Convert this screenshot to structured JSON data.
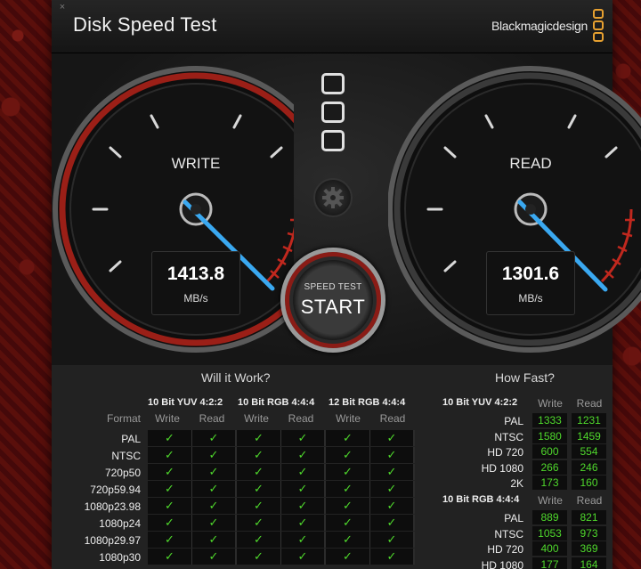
{
  "window": {
    "title": "Disk Speed Test",
    "brand": "Blackmagicdesign",
    "close_glyph": "×"
  },
  "colors": {
    "accent_red": "#c0281e",
    "needle_blue": "#3aa8f0",
    "check_green": "#4fd82c",
    "brand_orange": "#e6a030"
  },
  "gauges": {
    "write": {
      "label": "WRITE",
      "value": "1413.8",
      "unit": "MB/s"
    },
    "read": {
      "label": "READ",
      "value": "1301.6",
      "unit": "MB/s"
    }
  },
  "controls": {
    "start_small": "SPEED TEST",
    "start_big": "START",
    "settings_icon": "gear-icon"
  },
  "will_it_work": {
    "title": "Will it Work?",
    "format_header": "Format",
    "groups": [
      {
        "name": "10 Bit YUV 4:2:2",
        "write": "Write",
        "read": "Read"
      },
      {
        "name": "10 Bit RGB 4:4:4",
        "write": "Write",
        "read": "Read"
      },
      {
        "name": "12 Bit RGB 4:4:4",
        "write": "Write",
        "read": "Read"
      }
    ],
    "rows": [
      "PAL",
      "NTSC",
      "720p50",
      "720p59.94",
      "1080p23.98",
      "1080p24",
      "1080p29.97",
      "1080p30"
    ],
    "check_glyph": "✓"
  },
  "how_fast": {
    "title": "How Fast?",
    "sections": [
      {
        "name": "10 Bit YUV 4:2:2",
        "write": "Write",
        "read": "Read",
        "rows": [
          {
            "format": "PAL",
            "write": "1333",
            "read": "1231"
          },
          {
            "format": "NTSC",
            "write": "1580",
            "read": "1459"
          },
          {
            "format": "HD 720",
            "write": "600",
            "read": "554"
          },
          {
            "format": "HD 1080",
            "write": "266",
            "read": "246"
          },
          {
            "format": "2K",
            "write": "173",
            "read": "160"
          }
        ]
      },
      {
        "name": "10 Bit RGB 4:4:4",
        "write": "Write",
        "read": "Read",
        "rows": [
          {
            "format": "PAL",
            "write": "889",
            "read": "821"
          },
          {
            "format": "NTSC",
            "write": "1053",
            "read": "973"
          },
          {
            "format": "HD 720",
            "write": "400",
            "read": "369"
          },
          {
            "format": "HD 1080",
            "write": "177",
            "read": "164"
          }
        ]
      }
    ]
  }
}
